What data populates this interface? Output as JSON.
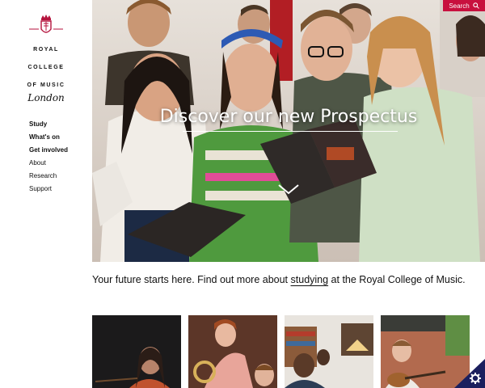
{
  "sidebar": {
    "logo": {
      "line1": "ROYAL",
      "line2": "COLLEGE",
      "line3": "OF MUSIC",
      "city": "London",
      "brand_color": "#b4123c"
    },
    "nav": [
      {
        "label": "Study",
        "bold": true
      },
      {
        "label": "What's on",
        "bold": true
      },
      {
        "label": "Get involved",
        "bold": true
      },
      {
        "label": "About",
        "bold": false
      },
      {
        "label": "Research",
        "bold": false
      },
      {
        "label": "Support",
        "bold": false
      }
    ]
  },
  "header": {
    "search": {
      "label": "Search",
      "icon": "search-icon",
      "color": "#c8103e"
    }
  },
  "hero": {
    "title": "Discover our new Prospectus",
    "cta_icon": "chevron-down-icon"
  },
  "intro": {
    "before": "Your future starts here. Find out more about ",
    "link": "studying",
    "after": " at the Royal College of Music."
  },
  "cookie_settings": {
    "icon": "gear-icon"
  }
}
